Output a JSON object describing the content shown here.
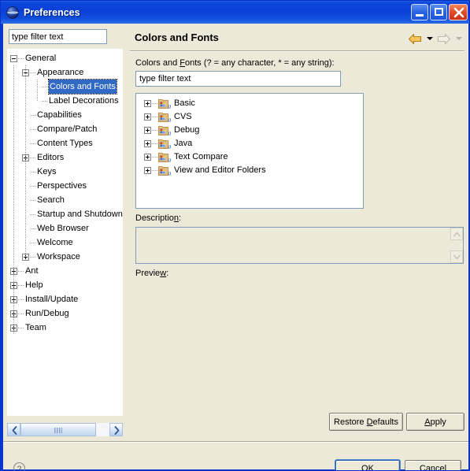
{
  "window": {
    "title": "Preferences",
    "icon": "globe-icon",
    "minimize_label": "Minimize",
    "maximize_label": "Maximize",
    "close_label": "Close",
    "titlebar_color": "#0a3fd6"
  },
  "left_pane": {
    "filter": {
      "value": "type filter text",
      "placeholder": "type filter text"
    },
    "tree": [
      {
        "label": "General",
        "depth": 0,
        "expander": "minus",
        "selected": false
      },
      {
        "label": "Appearance",
        "depth": 1,
        "expander": "minus",
        "selected": false
      },
      {
        "label": "Colors and Fonts",
        "depth": 2,
        "expander": "none",
        "selected": true
      },
      {
        "label": "Label Decorations",
        "depth": 2,
        "expander": "none",
        "selected": false
      },
      {
        "label": "Capabilities",
        "depth": 1,
        "expander": "none",
        "selected": false
      },
      {
        "label": "Compare/Patch",
        "depth": 1,
        "expander": "none",
        "selected": false
      },
      {
        "label": "Content Types",
        "depth": 1,
        "expander": "none",
        "selected": false
      },
      {
        "label": "Editors",
        "depth": 1,
        "expander": "plus",
        "selected": false
      },
      {
        "label": "Keys",
        "depth": 1,
        "expander": "none",
        "selected": false
      },
      {
        "label": "Perspectives",
        "depth": 1,
        "expander": "none",
        "selected": false
      },
      {
        "label": "Search",
        "depth": 1,
        "expander": "none",
        "selected": false
      },
      {
        "label": "Startup and Shutdown",
        "depth": 1,
        "expander": "none",
        "selected": false
      },
      {
        "label": "Web Browser",
        "depth": 1,
        "expander": "none",
        "selected": false
      },
      {
        "label": "Welcome",
        "depth": 1,
        "expander": "none",
        "selected": false
      },
      {
        "label": "Workspace",
        "depth": 1,
        "expander": "plus",
        "selected": false
      },
      {
        "label": "Ant",
        "depth": 0,
        "expander": "plus",
        "selected": false
      },
      {
        "label": "Help",
        "depth": 0,
        "expander": "plus",
        "selected": false
      },
      {
        "label": "Install/Update",
        "depth": 0,
        "expander": "plus",
        "selected": false
      },
      {
        "label": "Run/Debug",
        "depth": 0,
        "expander": "plus",
        "selected": false
      },
      {
        "label": "Team",
        "depth": 0,
        "expander": "plus",
        "selected": false
      }
    ],
    "scrollbar": {
      "left_arrow": "scroll-left",
      "right_arrow": "scroll-right"
    }
  },
  "right_pane": {
    "page_title": "Colors and Fonts",
    "nav": {
      "back": "back-arrow",
      "back_enabled": true,
      "back_color": "#e8a31c",
      "forward": "forward-arrow",
      "forward_enabled": false,
      "forward_color": "#d8d5c6"
    },
    "filter_label_prefix": "Colors and ",
    "filter_label_mnemonic": "F",
    "filter_label_suffix": "onts (? = any character, * = any string):",
    "filter": {
      "value": "type filter text",
      "placeholder": "type filter text"
    },
    "categories": [
      {
        "label": "Basic",
        "icon": "colors-fonts-folder-icon",
        "expander": "plus"
      },
      {
        "label": "CVS",
        "icon": "colors-fonts-folder-icon",
        "expander": "plus"
      },
      {
        "label": "Debug",
        "icon": "colors-fonts-folder-icon",
        "expander": "plus"
      },
      {
        "label": "Java",
        "icon": "colors-fonts-folder-icon",
        "expander": "plus"
      },
      {
        "label": "Text Compare",
        "icon": "colors-fonts-folder-icon",
        "expander": "plus"
      },
      {
        "label": "View and Editor Folders",
        "icon": "colors-fonts-folder-icon",
        "expander": "plus"
      }
    ],
    "description_label_prefix": "Descriptio",
    "description_label_mnemonic": "n",
    "description_label_suffix": ":",
    "description_value": "",
    "preview_label_prefix": "Previe",
    "preview_label_mnemonic": "w",
    "preview_label_suffix": ":",
    "preview_value": ""
  },
  "buttons": {
    "restore_prefix": "Restore ",
    "restore_mnemonic": "D",
    "restore_suffix": "efaults",
    "apply_mnemonic": "A",
    "apply_suffix": "pply",
    "ok": "OK",
    "cancel": "Cancel",
    "help": "help-icon"
  }
}
